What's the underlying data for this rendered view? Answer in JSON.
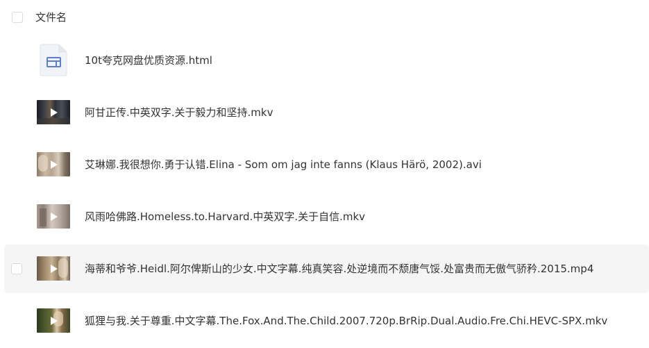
{
  "header": {
    "column_label": "文件名"
  },
  "files": [
    {
      "name": "10t夸克网盘优质资源.html",
      "type": "html",
      "icon": "html-file-icon"
    },
    {
      "name": "阿甘正传.中英双字.关于毅力和坚持.mkv",
      "type": "video",
      "icon": "video-thumbnail"
    },
    {
      "name": "艾琳娜.我很想你.勇于认错.Elina - Som om jag inte fanns (Klaus Härö, 2002).avi",
      "type": "video",
      "icon": "video-thumbnail"
    },
    {
      "name": "风雨哈佛路.Homeless.to.Harvard.中英双字.关于自信.mkv",
      "type": "video",
      "icon": "video-thumbnail"
    },
    {
      "name": "海蒂和爷爷.Heidl.阿尔俾斯山的少女.中文字幕.纯真笑容.处逆境而不颓唐气馁.处富贵而无傲气骄矜.2015.mp4",
      "type": "video",
      "icon": "video-thumbnail",
      "hovered": true
    },
    {
      "name": "狐狸与我.关于尊重.中文字幕.The.Fox.And.The.Child.2007.720p.BrRip.Dual.Audio.Fre.Chi.HEVC-SPX.mkv",
      "type": "video",
      "icon": "video-thumbnail"
    }
  ],
  "colors": {
    "text": "#333333",
    "hover_row": "#f5f5f6",
    "checkbox_border": "#d9dbe0",
    "html_icon_blue": "#5b7fcf"
  }
}
